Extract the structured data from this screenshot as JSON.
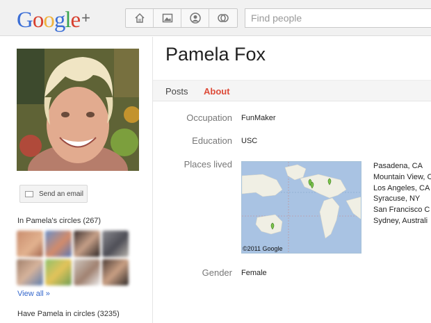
{
  "header": {
    "logo_text": "Google+",
    "search": {
      "placeholder": "Find people"
    },
    "nav_icons": [
      "home-icon",
      "photos-icon",
      "profile-icon",
      "circles-icon"
    ]
  },
  "profile": {
    "name": "Pamela Fox",
    "email_button": "Send an email",
    "circles_heading": "In Pamela's circles (267)",
    "view_all": "View all »",
    "have_in_circles": "Have Pamela in circles (3235)"
  },
  "tabs": [
    {
      "label": "Posts",
      "active": false
    },
    {
      "label": "About",
      "active": true
    }
  ],
  "about": {
    "occupation": {
      "label": "Occupation",
      "value": "FunMaker"
    },
    "education": {
      "label": "Education",
      "value": "USC"
    },
    "places_lived": {
      "label": "Places lived",
      "map_credit": "©2011 Google",
      "places": [
        "Pasadena, CA",
        "Mountain View, C",
        "Los Angeles, CA",
        "Syracuse, NY",
        "San Francisco C",
        "Sydney, Australi"
      ]
    },
    "gender": {
      "label": "Gender",
      "value": "Female"
    }
  },
  "colors": {
    "accent": "#dd4b39",
    "link": "#3366cc"
  }
}
